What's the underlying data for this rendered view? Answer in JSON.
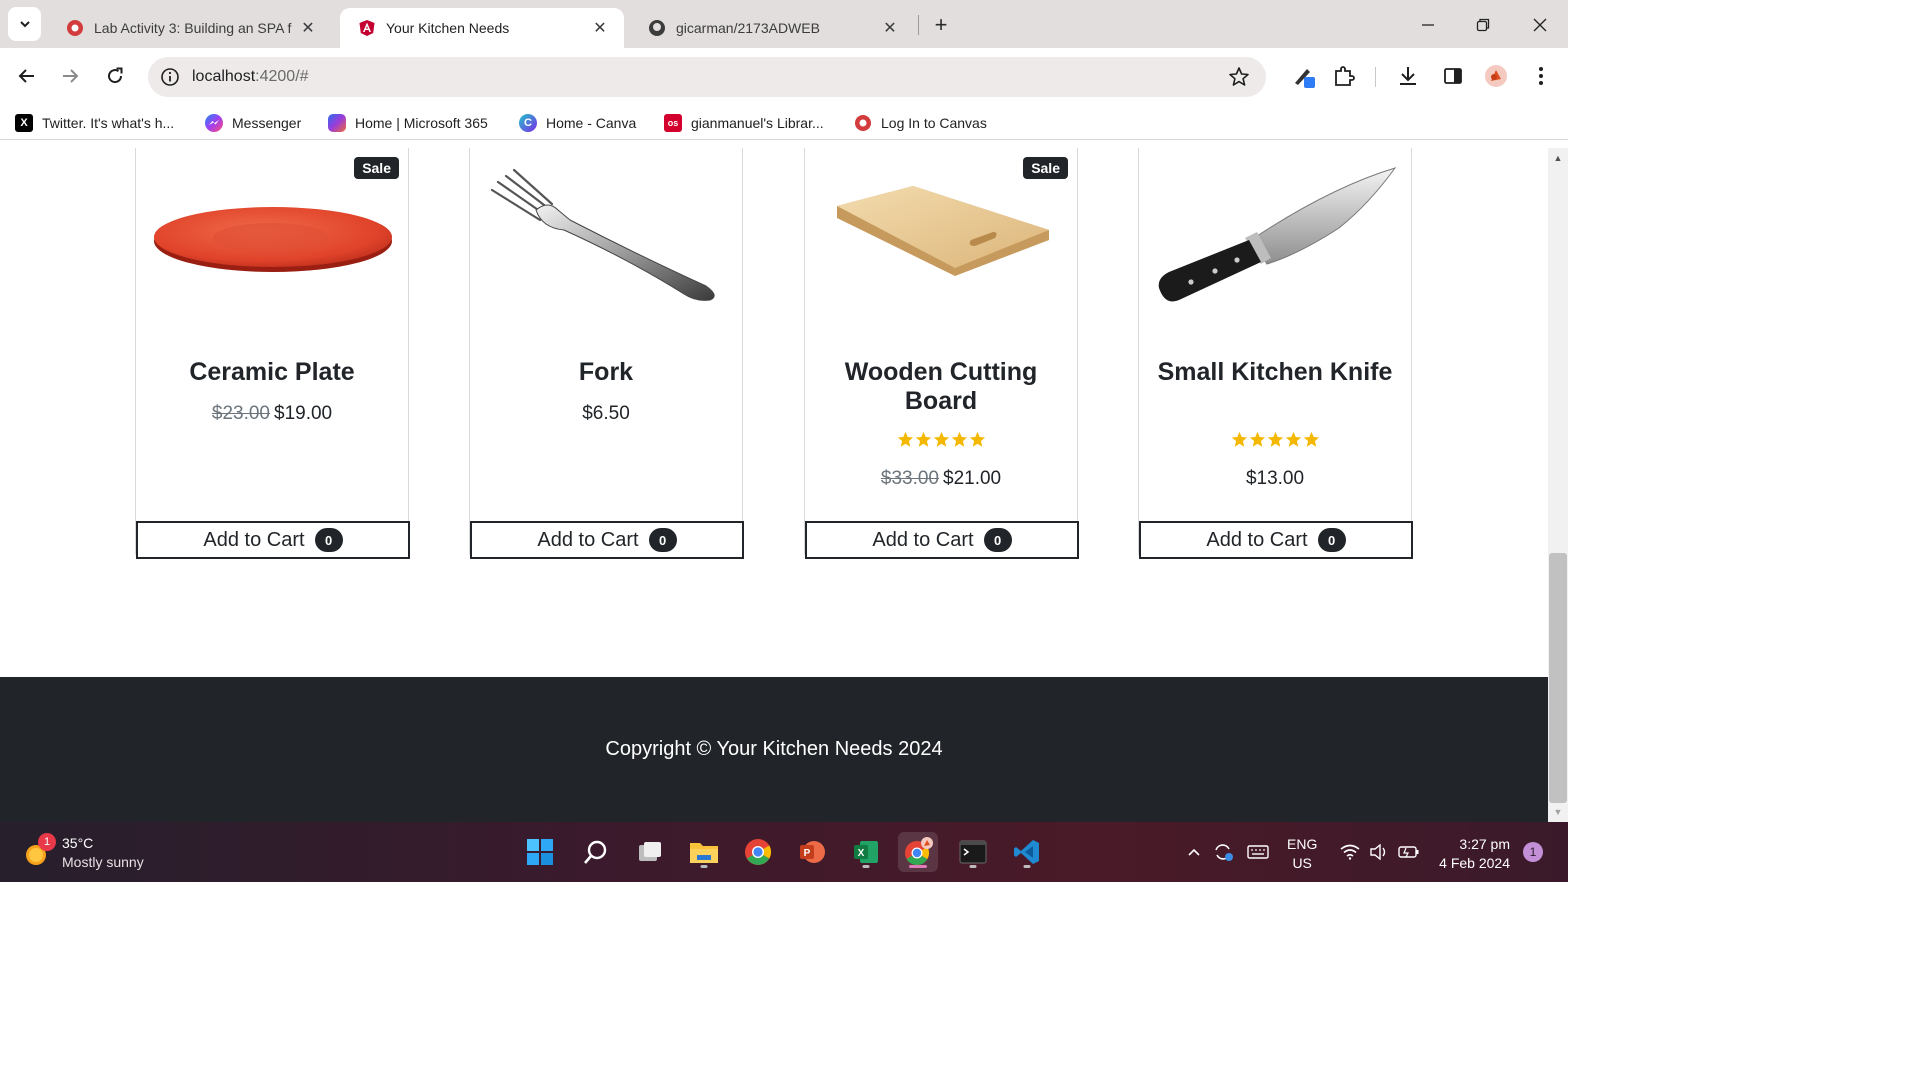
{
  "tabs": [
    {
      "title": "Lab Activity 3: Building an SPA f",
      "active": false
    },
    {
      "title": "Your Kitchen Needs",
      "active": true
    },
    {
      "title": "gicarman/2173ADWEB",
      "active": false
    }
  ],
  "toolbar": {
    "url_host": "localhost",
    "url_rest": ":4200/#"
  },
  "bookmarks": [
    {
      "label": "Twitter. It's what's h...",
      "icon": "x-icon"
    },
    {
      "label": "Messenger",
      "icon": "messenger-icon"
    },
    {
      "label": "Home | Microsoft 365",
      "icon": "microsoft365-icon"
    },
    {
      "label": "Home - Canva",
      "icon": "canva-icon"
    },
    {
      "label": "gianmanuel's Librar...",
      "icon": "oreilly-icon"
    },
    {
      "label": "Log In to Canvas",
      "icon": "canvas-icon"
    }
  ],
  "products": [
    {
      "name": "Ceramic Plate",
      "sale_badge": "Sale",
      "old_price": "$23.00",
      "price": "$19.00",
      "rating": null,
      "cart_label": "Add to Cart",
      "cart_count": "0",
      "image": "plate"
    },
    {
      "name": "Fork",
      "sale_badge": null,
      "old_price": null,
      "price": "$6.50",
      "rating": null,
      "cart_label": "Add to Cart",
      "cart_count": "0",
      "image": "fork"
    },
    {
      "name": "Wooden Cutting Board",
      "sale_badge": "Sale",
      "old_price": "$33.00",
      "price": "$21.00",
      "rating": 5,
      "cart_label": "Add to Cart",
      "cart_count": "0",
      "image": "board"
    },
    {
      "name": "Small Kitchen Knife",
      "sale_badge": null,
      "old_price": null,
      "price": "$13.00",
      "rating": 5,
      "cart_label": "Add to Cart",
      "cart_count": "0",
      "image": "knife"
    }
  ],
  "footer": {
    "text": "Copyright © Your Kitchen Needs 2024"
  },
  "taskbar": {
    "weather_badge": "1",
    "temperature": "35°C",
    "condition": "Mostly sunny",
    "lang_1": "ENG",
    "lang_2": "US",
    "time": "3:27 pm",
    "date": "4 Feb 2024",
    "notification_count": "1"
  },
  "colors": {
    "dark": "#212529",
    "star": "#f5b800",
    "accent_tab": "#e3dede"
  }
}
